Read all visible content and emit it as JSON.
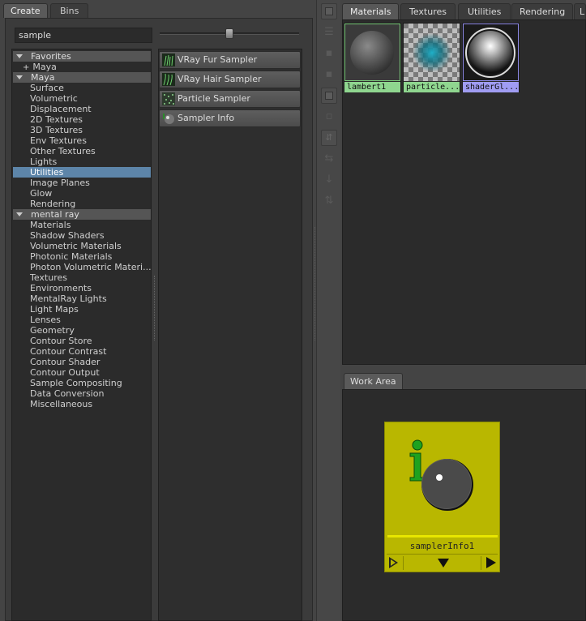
{
  "left_tabs": {
    "create": "Create",
    "bins": "Bins"
  },
  "search": {
    "value": "sample"
  },
  "tree": {
    "favorites": "Favorites",
    "favorites_maya": "Maya",
    "maya": "Maya",
    "maya_items": [
      "Surface",
      "Volumetric",
      "Displacement",
      "2D Textures",
      "3D Textures",
      "Env Textures",
      "Other Textures",
      "Lights",
      "Utilities",
      "Image Planes",
      "Glow",
      "Rendering"
    ],
    "selected": "Utilities",
    "mental_ray": "mental ray",
    "mental_ray_items": [
      "Materials",
      "Shadow Shaders",
      "Volumetric Materials",
      "Photonic Materials",
      "Photon Volumetric Materi...",
      "Textures",
      "Environments",
      "MentalRay Lights",
      "Light Maps",
      "Lenses",
      "Geometry",
      "Contour Store",
      "Contour Contrast",
      "Contour Shader",
      "Contour Output",
      "Sample Compositing",
      "Data Conversion",
      "Miscellaneous"
    ]
  },
  "node_list": [
    {
      "label": "VRay Fur Sampler",
      "icon": "vray-fur-icon"
    },
    {
      "label": "VRay Hair Sampler",
      "icon": "vray-hair-icon"
    },
    {
      "label": "Particle Sampler",
      "icon": "particle-sampler-icon"
    },
    {
      "label": "Sampler Info",
      "icon": "sampler-info-icon"
    }
  ],
  "right_tabs": [
    "Materials",
    "Textures",
    "Utilities",
    "Rendering",
    "L"
  ],
  "materials": [
    {
      "name": "lambert1",
      "color": "#8fd68f"
    },
    {
      "name": "particle...",
      "color": "#8fd68f"
    },
    {
      "name": "shaderGl...",
      "color": "#a09cf2"
    }
  ],
  "work_area": {
    "tab": "Work Area",
    "node_label": "samplerInfo1",
    "node_color": "#b9b700"
  }
}
